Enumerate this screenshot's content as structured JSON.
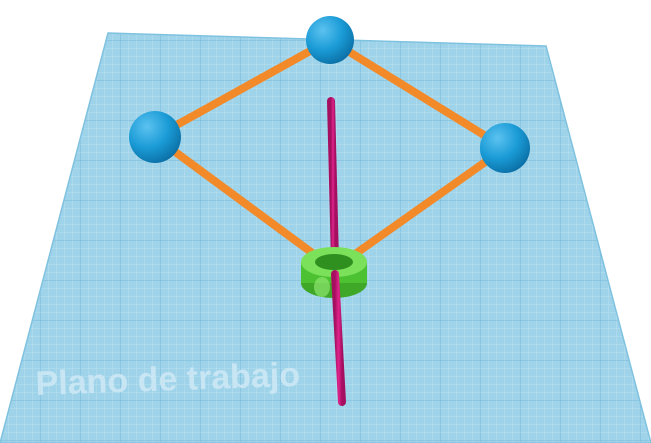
{
  "workplane": {
    "label": "Plano de trabajo",
    "fill_color": "#9fd3ea",
    "grid_minor_color": "#c7e6f3",
    "grid_major_color": "#6fb7d8"
  },
  "model": {
    "sphere_color": "#1a9bd6",
    "rod_color": "#f28a2a",
    "ring_color": "#5fcf3f",
    "axis_color": "#d8147f"
  }
}
